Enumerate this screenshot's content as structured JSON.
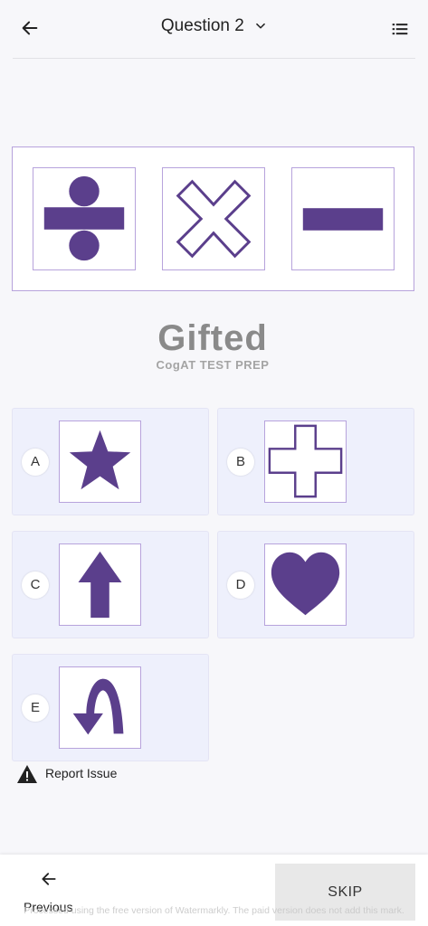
{
  "header": {
    "title": "Question 2",
    "icons": [
      "arrow-left-icon",
      "chevron-down-icon",
      "list-icon"
    ]
  },
  "question": {
    "figures": [
      "division-sign",
      "multiplication-sign-outline",
      "minus-sign"
    ]
  },
  "logo": {
    "line1": "Gifted",
    "line2": "CogAT TEST PREP"
  },
  "options": [
    {
      "letter": "A",
      "figure": "star"
    },
    {
      "letter": "B",
      "figure": "plus-outline"
    },
    {
      "letter": "C",
      "figure": "arrow-up"
    },
    {
      "letter": "D",
      "figure": "heart"
    },
    {
      "letter": "E",
      "figure": "u-turn-arrow"
    }
  ],
  "report": {
    "label": "Report Issue",
    "icon": "warning-icon"
  },
  "footer": {
    "previous_label": "Previous",
    "skip_label": "SKIP",
    "watermark": "Processed using the free version of Watermarkly. The paid version does not add this mark."
  },
  "colors": {
    "accent": "#5b3f8c",
    "border": "#b7a3dc",
    "option_bg": "#eef0fc"
  }
}
